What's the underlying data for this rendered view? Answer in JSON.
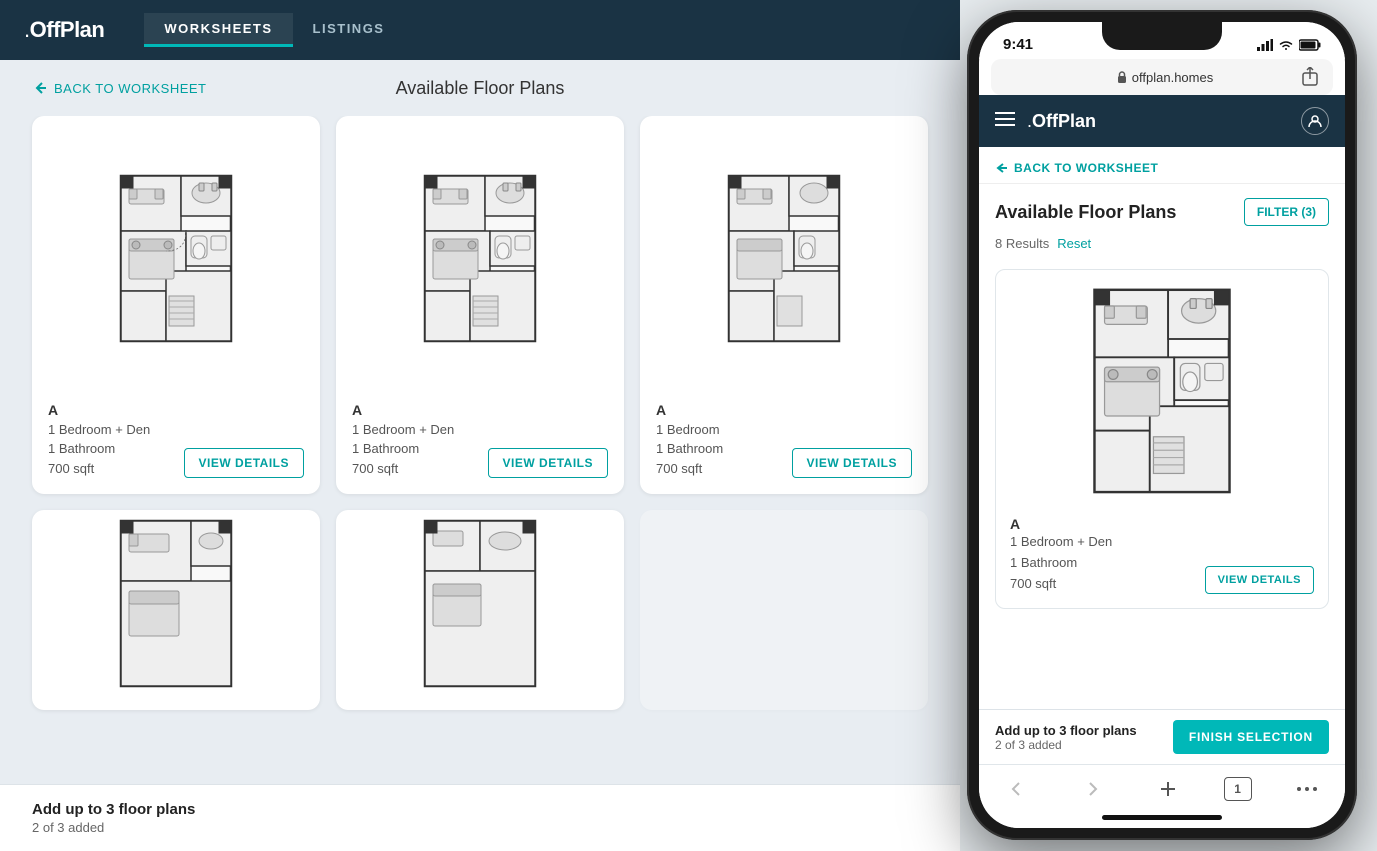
{
  "desktop": {
    "logo": "OffPlan",
    "nav": {
      "links": [
        {
          "label": "WORKSHEETS",
          "active": true
        },
        {
          "label": "LISTINGS",
          "active": false
        }
      ]
    },
    "back_link": "BACK TO WORKSHEET",
    "page_title": "Available Floor Plans",
    "cards": [
      {
        "id": "A1",
        "label": "A",
        "bedroom": "1 Bedroom + Den",
        "bathroom": "1 Bathroom",
        "sqft": "700 sqft",
        "view_btn": "VIEW DETAILS"
      },
      {
        "id": "A2",
        "label": "A",
        "bedroom": "1 Bedroom + Den",
        "bathroom": "1 Bathroom",
        "sqft": "700 sqft",
        "view_btn": "VIEW DETAILS"
      },
      {
        "id": "A3",
        "label": "A",
        "bedroom": "1 Bedroom",
        "bathroom": "1 Bathroom",
        "sqft": "700 sqft",
        "view_btn": "VIEW DETAILS"
      }
    ],
    "footer": {
      "add_text": "Add up to 3 floor plans",
      "added_text": "2 of 3 added"
    }
  },
  "phone": {
    "status_bar": {
      "time": "9:41",
      "signal": "▐▐▐▐",
      "wifi": "WiFi",
      "battery": "🔋"
    },
    "url": "offplan.homes",
    "logo": "OffPlan",
    "back_link": "BACK TO WORKSHEET",
    "page_title": "Available Floor Plans",
    "filter_btn": "FILTER (3)",
    "results": {
      "count": "8 Results",
      "reset": "Reset"
    },
    "card": {
      "label": "A",
      "bedroom": "1 Bedroom + Den",
      "bathroom": "1 Bathroom",
      "sqft": "700 sqft",
      "view_btn": "VIEW DETAILS"
    },
    "bottom_bar": {
      "add_text": "Add up to 3 floor plans",
      "added_text": "2 of 3 added",
      "finish_btn": "FINISH SELECTION"
    }
  }
}
